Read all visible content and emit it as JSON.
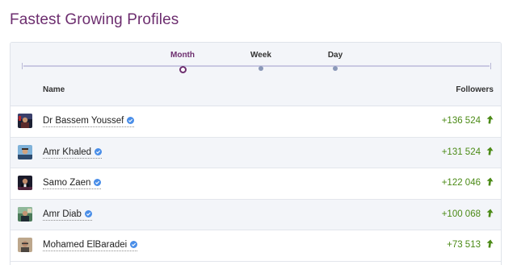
{
  "title": "Fastest Growing Profiles",
  "periods": [
    {
      "label": "Month",
      "active": true
    },
    {
      "label": "Week",
      "active": false
    },
    {
      "label": "Day",
      "active": false
    }
  ],
  "columns": {
    "name": "Name",
    "followers": "Followers"
  },
  "profiles": [
    {
      "name": "Dr Bassem Youssef",
      "followers": "+136 524",
      "verified": true
    },
    {
      "name": "Amr Khaled",
      "followers": "+131 524",
      "verified": true
    },
    {
      "name": "Samo Zaen",
      "followers": "+122 046",
      "verified": true
    },
    {
      "name": "Amr Diab",
      "followers": "+100 068",
      "verified": true
    },
    {
      "name": "Mohamed ElBaradei",
      "followers": "+73 513",
      "verified": true
    }
  ],
  "colors": {
    "title": "#6d2e6f",
    "growth": "#4b8a16",
    "verified": "#4a8ee8"
  },
  "icons": {
    "verified": "verified-badge-icon",
    "trend": "trend-up-arrow-icon"
  }
}
